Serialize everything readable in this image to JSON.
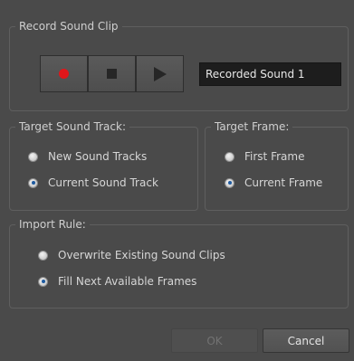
{
  "record_group": {
    "title": "Record Sound Clip",
    "record_icon": "record-icon",
    "stop_icon": "stop-icon",
    "play_icon": "play-icon",
    "sound_name": "Recorded Sound 1",
    "record_color": "#e0161a"
  },
  "track_group": {
    "title": "Target Sound Track:",
    "options": [
      {
        "label": "New Sound Tracks",
        "checked": false
      },
      {
        "label": "Current Sound Track",
        "checked": true
      }
    ]
  },
  "frame_group": {
    "title": "Target Frame:",
    "options": [
      {
        "label": "First Frame",
        "checked": false
      },
      {
        "label": "Current Frame",
        "checked": true
      }
    ]
  },
  "import_group": {
    "title": "Import Rule:",
    "options": [
      {
        "label": "Overwrite Existing Sound Clips",
        "checked": false
      },
      {
        "label": "Fill Next Available Frames",
        "checked": true
      }
    ]
  },
  "buttons": {
    "ok_label": "OK",
    "ok_enabled": false,
    "cancel_label": "Cancel"
  }
}
